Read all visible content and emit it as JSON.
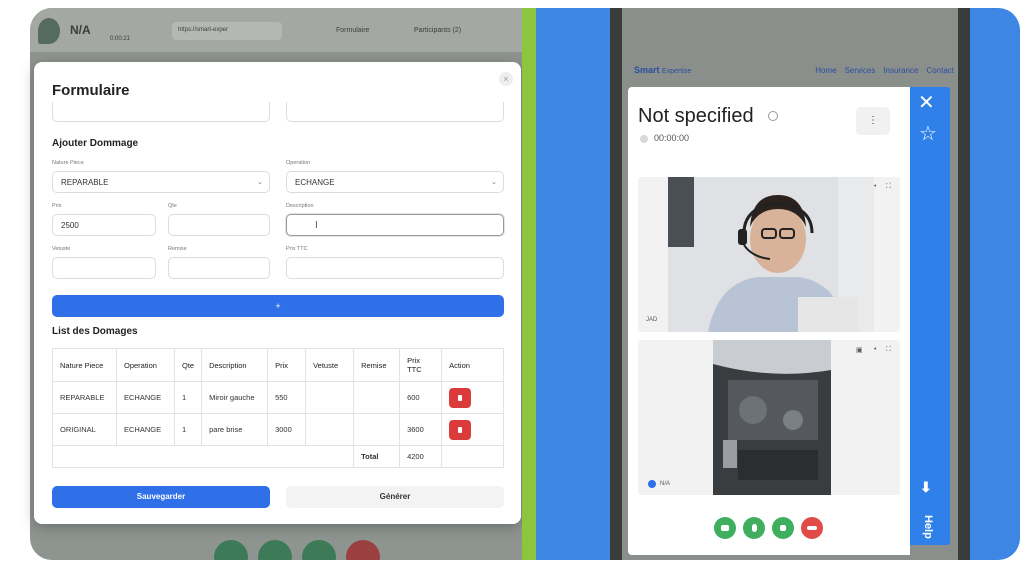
{
  "background_app": {
    "title": "N/A",
    "subtitle": "0:00:21",
    "url": "https://smart-exper",
    "formulaire_tab": "Formulaire",
    "participants_tab": "Participants (2)"
  },
  "modal": {
    "title": "Formulaire",
    "close_icon": "×",
    "add_damage": {
      "section_title": "Ajouter Dommage",
      "nature_piece_label": "Nature Piece",
      "nature_piece_value": "REPARABLE",
      "operation_label": "Operation",
      "operation_value": "ECHANGE",
      "prix_label": "Prix",
      "prix_value": "2500",
      "qte_label": "Qte",
      "qte_value": "",
      "description_label": "Description",
      "description_value": "I",
      "vetuste_label": "Vetuste",
      "vetuste_value": "",
      "remise_label": "Remise",
      "remise_value": "",
      "prix_ttc_label": "Prix TTC",
      "prix_ttc_value": "",
      "add_button": "+"
    },
    "damages_list": {
      "section_title": "List des Domages",
      "headers": [
        "Nature Piece",
        "Operation",
        "Qte",
        "Description",
        "Prix",
        "Vetuste",
        "Remise",
        "Prix TTC",
        "Action"
      ],
      "rows": [
        {
          "nature": "REPARABLE",
          "operation": "ECHANGE",
          "qte": "1",
          "description": "Miroir gauche",
          "prix": "550",
          "vetuste": "",
          "remise": "",
          "prix_ttc": "600"
        },
        {
          "nature": "ORIGINAL",
          "operation": "ECHANGE",
          "qte": "1",
          "description": "pare brise",
          "prix": "3000",
          "vetuste": "",
          "remise": "",
          "prix_ttc": "3600"
        }
      ],
      "total_label": "Total",
      "total_value": "4200"
    },
    "save_button": "Sauvegarder",
    "generate_button": "Générer"
  },
  "website": {
    "logo_main": "Smart",
    "logo_sub": "Expertise",
    "nav": [
      "Home",
      "Services",
      "Insurance",
      "Contact"
    ]
  },
  "call_widget": {
    "title": "Not specified",
    "timer": "00:00:00",
    "menu_icon": "⋮",
    "tile1_label": "JAD",
    "tile2_label": "N/A",
    "help_label": "Help"
  },
  "colors": {
    "primary": "#2f6fe8",
    "danger": "#dc3b3b",
    "call_green": "#3fae5f",
    "divider_green": "#8cc63f",
    "help_blue": "#2f80e8"
  },
  "icons": [
    "close-icon",
    "star-icon",
    "download-arrow-icon",
    "info-icon",
    "kebab-menu-icon",
    "trash-icon",
    "camera-icon",
    "mic-icon",
    "speaker-icon",
    "hangup-icon"
  ]
}
